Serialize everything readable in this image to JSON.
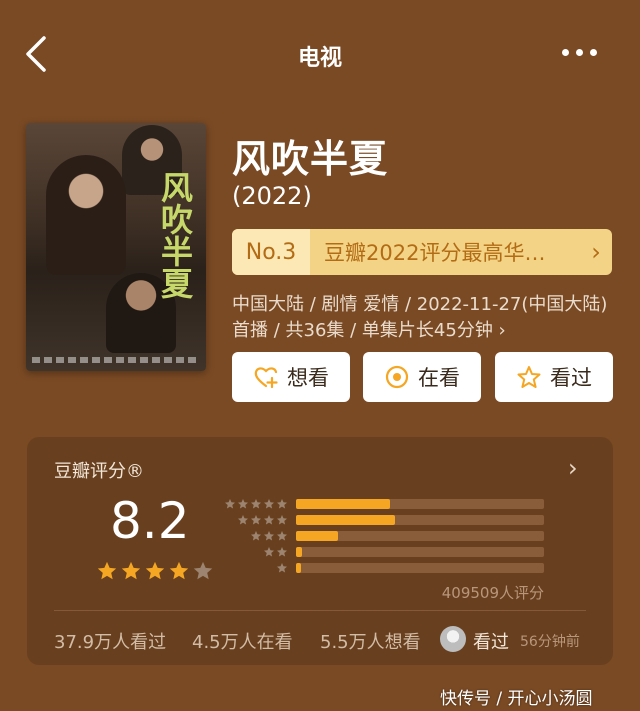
{
  "header": {
    "title": "电视"
  },
  "show": {
    "title": "风吹半夏",
    "year": "(2022)",
    "poster_title": "风吹半夏"
  },
  "rank": {
    "number": "No.3",
    "text": "豆瓣2022评分最高华…"
  },
  "meta": "中国大陆 / 剧情 爱情 / 2022-11-27(中国大陆)首播 / 共36集 / 单集片长45分钟 ›",
  "actions": {
    "want": "想看",
    "doing": "在看",
    "done": "看过"
  },
  "rating": {
    "label": "豆瓣评分®",
    "score": "8.2",
    "stars": 4,
    "count": "409509人评分",
    "distribution": [
      0.38,
      0.4,
      0.17,
      0.025,
      0.02
    ]
  },
  "stats": {
    "watched": "37.9万人看过",
    "watching": "4.5万人在看",
    "wish": "5.5万人想看",
    "my_status": "看过",
    "my_time": "56分钟前"
  },
  "watermark": "快传号 / 开心小汤圆",
  "colors": {
    "background": "#7a4a24",
    "card": "#69401f",
    "accent": "#f5a623",
    "rank_text": "#b36b15"
  }
}
